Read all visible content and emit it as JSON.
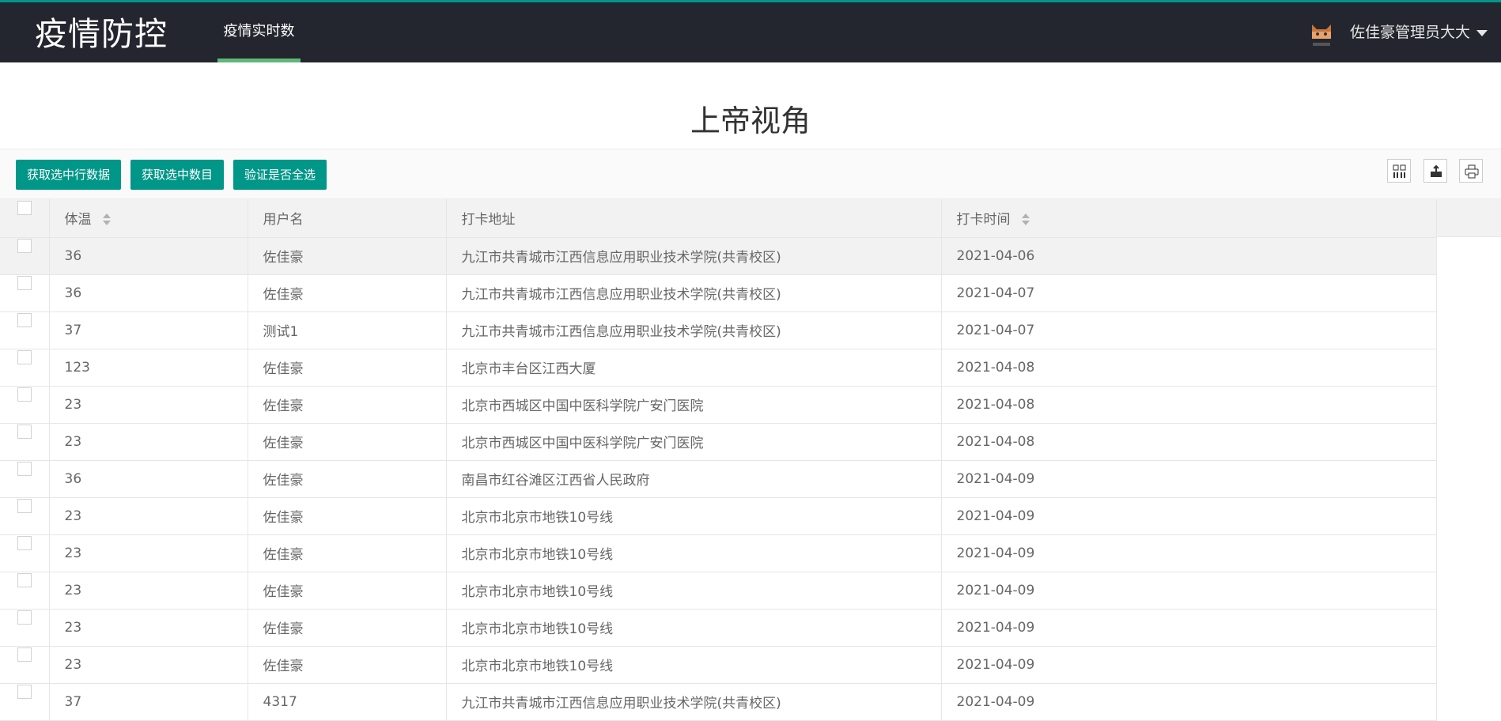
{
  "app": {
    "logo": "疫情防控",
    "nav_tab": "疫情实时数据",
    "user_name": "佐佳豪管理员大大"
  },
  "colors": {
    "primary": "#009688",
    "nav_bg": "#23262e",
    "nav_active": "#5fb878"
  },
  "page": {
    "title": "上帝视角"
  },
  "toolbar": {
    "buttons": [
      "获取选中行数据",
      "获取选中数目",
      "验证是否全选"
    ],
    "icons": [
      "columns-icon",
      "export-icon",
      "print-icon"
    ]
  },
  "table": {
    "columns": [
      "体温",
      "用户名",
      "打卡地址",
      "打卡时间"
    ],
    "rows": [
      {
        "temp": "36",
        "user": "佐佳豪",
        "addr": "九江市共青城市江西信息应用职业技术学院(共青校区)",
        "time": "2021-04-06"
      },
      {
        "temp": "36",
        "user": "佐佳豪",
        "addr": "九江市共青城市江西信息应用职业技术学院(共青校区)",
        "time": "2021-04-07"
      },
      {
        "temp": "37",
        "user": "测试1",
        "addr": "九江市共青城市江西信息应用职业技术学院(共青校区)",
        "time": "2021-04-07"
      },
      {
        "temp": "123",
        "user": "佐佳豪",
        "addr": "北京市丰台区江西大厦",
        "time": "2021-04-08"
      },
      {
        "temp": "23",
        "user": "佐佳豪",
        "addr": "北京市西城区中国中医科学院广安门医院",
        "time": "2021-04-08"
      },
      {
        "temp": "23",
        "user": "佐佳豪",
        "addr": "北京市西城区中国中医科学院广安门医院",
        "time": "2021-04-08"
      },
      {
        "temp": "36",
        "user": "佐佳豪",
        "addr": "南昌市红谷滩区江西省人民政府",
        "time": "2021-04-09"
      },
      {
        "temp": "23",
        "user": "佐佳豪",
        "addr": "北京市北京市地铁10号线",
        "time": "2021-04-09"
      },
      {
        "temp": "23",
        "user": "佐佳豪",
        "addr": "北京市北京市地铁10号线",
        "time": "2021-04-09"
      },
      {
        "temp": "23",
        "user": "佐佳豪",
        "addr": "北京市北京市地铁10号线",
        "time": "2021-04-09"
      },
      {
        "temp": "23",
        "user": "佐佳豪",
        "addr": "北京市北京市地铁10号线",
        "time": "2021-04-09"
      },
      {
        "temp": "23",
        "user": "佐佳豪",
        "addr": "北京市北京市地铁10号线",
        "time": "2021-04-09"
      },
      {
        "temp": "37",
        "user": "4317",
        "addr": "九江市共青城市江西信息应用职业技术学院(共青校区)",
        "time": "2021-04-09"
      }
    ]
  }
}
